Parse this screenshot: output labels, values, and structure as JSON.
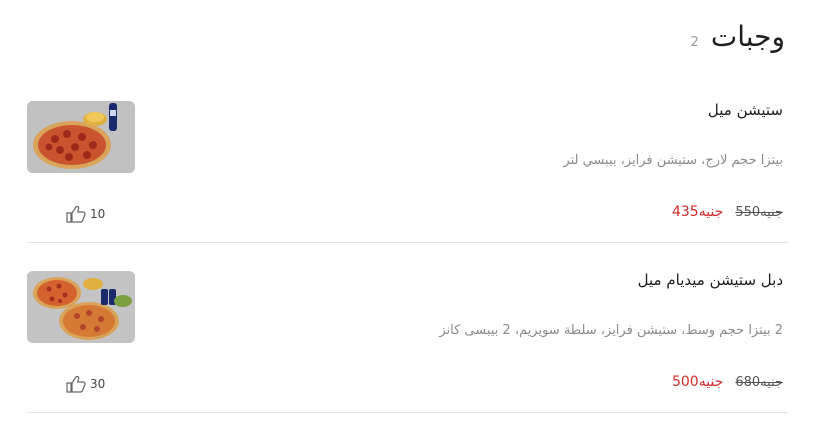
{
  "section": {
    "title": "وجبات",
    "count": "2"
  },
  "meals": [
    {
      "name": "ستيشن ميل",
      "description": "بيتزا حجم لارج، ستيشن فرايز، بيبسي لتر",
      "old_price": "550جنيه",
      "new_price": "435جنيه",
      "likes": "10",
      "image": "pizza-meal-photo"
    },
    {
      "name": "دبل ستيشن ميديام ميل",
      "description": "2 بيتزا حجم وسط، ستيشن فرايز، سلطة سويريم، 2 بيبسى كانز",
      "old_price": "680جنيه",
      "new_price": "500جنيه",
      "likes": "30",
      "image": "double-pizza-meal-photo"
    }
  ],
  "colors": {
    "new_price": "#d22b2b",
    "divider": "#e3e3e3"
  },
  "icons": {
    "likes": "thumbs-up-icon"
  }
}
